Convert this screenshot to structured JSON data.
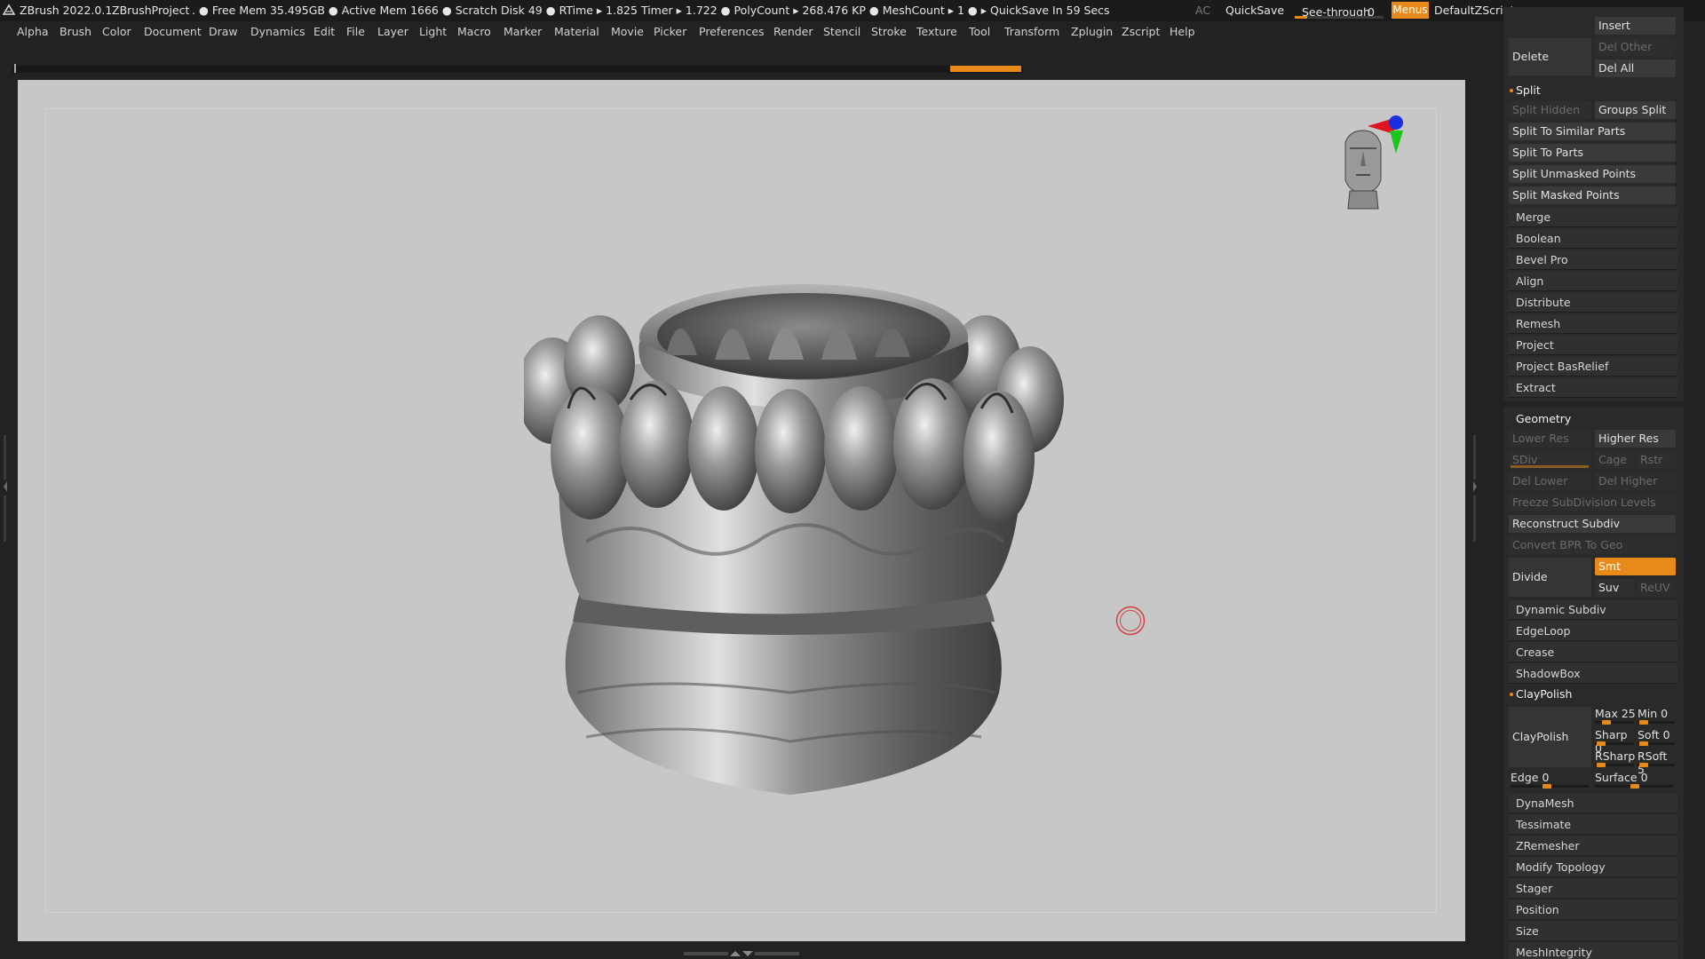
{
  "title_bar": {
    "app_title": "ZBrush 2022.0.1",
    "project_name": "ZBrushProject",
    "status": ". ● Free Mem 35.495GB ● Active Mem 1666 ● Scratch Disk 49 ● RTime ▸ 1.825 Timer ▸ 1.722 ● PolyCount ▸ 268.476 KP ● MeshCount ▸ 1 ● ▸ QuickSave In 59 Secs",
    "ac_label": "AC",
    "quicksave_label": "QuickSave",
    "seethrough_label": "See-through",
    "seethrough_value": "0",
    "seethrough_level": 0,
    "menus_label": "Menus",
    "default_zscript_label": "DefaultZScript",
    "icons": [
      "layout-icon-1",
      "layout-icon-2",
      "copy-window-icon",
      "monitor-icon",
      "minimize-icon",
      "restore-icon",
      "close-icon"
    ]
  },
  "menu_bar": {
    "items": [
      "Alpha",
      "Brush",
      "Color",
      "Document",
      "Draw",
      "Dynamics",
      "Edit",
      "File",
      "Layer",
      "Light",
      "Macro",
      "Marker",
      "Material",
      "Movie",
      "Picker",
      "Preferences",
      "Render",
      "Stencil",
      "Stroke",
      "Texture",
      "Tool",
      "Transform",
      "Zplugin",
      "Zscript",
      "Help"
    ]
  },
  "palette": {
    "subtool_top": {
      "insert_label": "Insert",
      "delete_label": "Delete",
      "del_other_label": "Del Other",
      "del_all_label": "Del All"
    },
    "split_section": {
      "header": "Split",
      "split_hidden": "Split Hidden",
      "groups_split": "Groups Split",
      "split_similar": "Split To Similar Parts",
      "split_parts": "Split To Parts",
      "split_unmasked": "Split Unmasked Points",
      "split_masked": "Split Masked Points"
    },
    "subtool_actions": [
      "Merge",
      "Boolean",
      "Bevel Pro",
      "Align",
      "Distribute",
      "Remesh",
      "Project",
      "Project BasRelief",
      "Extract"
    ],
    "geometry": {
      "header": "Geometry",
      "lower_res": "Lower Res",
      "higher_res": "Higher Res",
      "sdiv_label": "SDiv",
      "cage": "Cage",
      "rstr": "Rstr",
      "del_lower": "Del Lower",
      "del_higher": "Del Higher",
      "freeze_subdiv": "Freeze SubDivision Levels",
      "reconstruct_subdiv": "Reconstruct Subdiv",
      "convert_bpr": "Convert BPR To Geo",
      "divide": "Divide",
      "smt": "Smt",
      "suv": "Suv",
      "reuv": "ReUV",
      "dynamic_subdiv": "Dynamic Subdiv",
      "edgeloop": "EdgeLoop",
      "crease": "Crease",
      "shadowbox": "ShadowBox"
    },
    "claypolish": {
      "header": "ClayPolish",
      "button": "ClayPolish",
      "max_label": "Max",
      "max_value": "25",
      "min_label": "Min",
      "min_value": "0",
      "sharp_label": "Sharp",
      "sharp_value": "0",
      "soft_label": "Soft",
      "soft_value": "0",
      "rsharp_label": "RSharp",
      "rsharp_value": "",
      "rsoft_label": "RSoft",
      "rsoft_value": "5",
      "edge_label": "Edge",
      "edge_value": "0",
      "surface_label": "Surface",
      "surface_value": "0"
    },
    "geometry_more": [
      "DynaMesh",
      "Tessimate",
      "ZRemesher",
      "Modify Topology",
      "Stager",
      "Position",
      "Size",
      "MeshIntegrity"
    ]
  },
  "colors": {
    "accent": "#e88a1a",
    "background": "#222222",
    "viewport": "#c7c7c7",
    "nav_x": "#e0141e",
    "nav_y": "#19c619",
    "nav_z": "#1a2fe0"
  }
}
